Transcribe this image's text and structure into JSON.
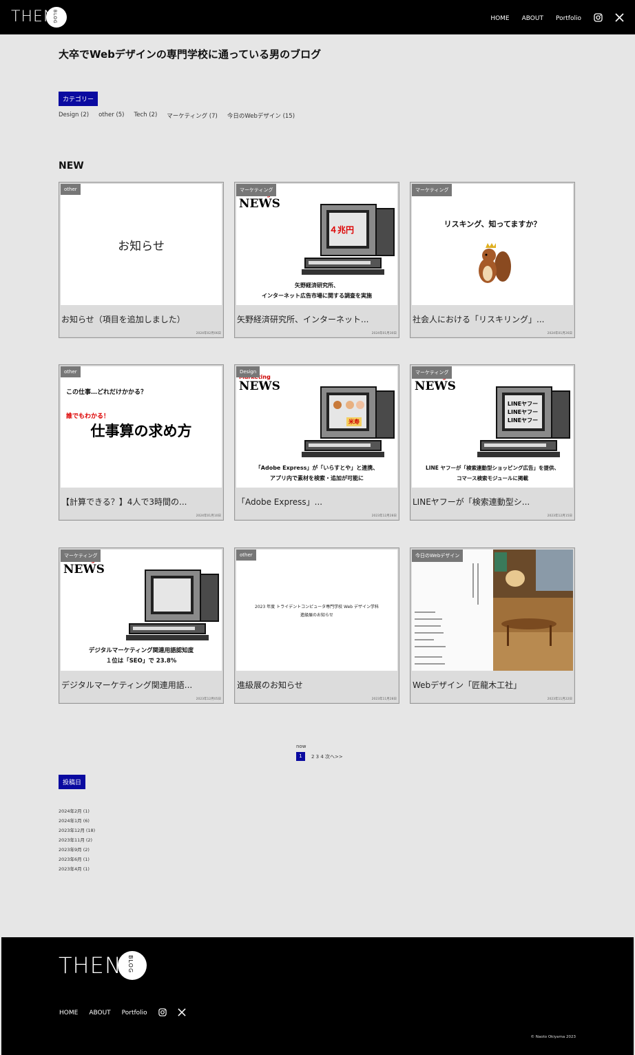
{
  "header": {
    "logo_text": "THEN",
    "logo_sub": "BLOG",
    "nav": [
      "HOME",
      "ABOUT",
      "Portfolio"
    ],
    "icons": [
      "instagram-icon",
      "x-icon"
    ]
  },
  "site_title": "大卒でWebデザインの専門学校に通っている男のブログ",
  "categories": {
    "label": "カテゴリー",
    "items": [
      "Design (2)",
      "other (5)",
      "Tech (2)",
      "マーケティング (7)",
      "今日のWebデザイン (15)"
    ]
  },
  "new_heading": "NEW",
  "cards": [
    {
      "tag": "other",
      "title": "お知らせ（項目を追加しました）",
      "date": "2024年02月06日",
      "thumb_text": "お知らせ"
    },
    {
      "tag": "マーケティング",
      "title": "矢野経済研究所、インターネット...",
      "date": "2024年01月30日",
      "news_mk": "Marketing",
      "news_word": "NEWS",
      "screen_text": "４兆円",
      "caption": [
        "矢野経済研究所、",
        "インターネット広告市場に関する調査を実施"
      ]
    },
    {
      "tag": "マーケティング",
      "title": "社会人における「リスキリング」...",
      "date": "2024年01月26日",
      "thumb_text": "リスキング、知ってますか？"
    },
    {
      "tag": "other",
      "title": "【計算できる？】4人で3時間の...",
      "date": "2024年01月10日",
      "line1": "この仕事…どれだけかかる？",
      "line2": "誰でもわかる！",
      "line3": "仕事算の求め方"
    },
    {
      "tag": "Design",
      "title": "「Adobe Express」...",
      "date": "2023年12月28日",
      "news_mk": "Marketing",
      "news_word": "NEWS",
      "screen_text": "米寿",
      "caption": [
        "「Adobe Express」が「いらすとや」と連携、",
        "アプリ内で素材を検索・追加が可能に"
      ]
    },
    {
      "tag": "マーケティング",
      "title": "LINEヤフーが「検索連動型シ...",
      "date": "2023年12月15日",
      "news_mk": "Marketing",
      "news_word": "NEWS",
      "screen_text": "LINEヤフー",
      "caption": [
        "LINE ヤフーが「検索連動型ショッピング広告」を提供、",
        "コマース検索モジュールに掲載"
      ]
    },
    {
      "tag": "マーケティング",
      "title": "デジタルマーケティング関連用語...",
      "date": "2023年12月05日",
      "news_mk": "Marketing",
      "news_word": "NEWS",
      "screen_text": "",
      "caption": [
        "デジタルマーケティング関連用語認知度",
        "１位は「SEO」で 23.8%"
      ]
    },
    {
      "tag": "other",
      "title": "進級展のお知らせ",
      "date": "2023年11月28日",
      "caption": [
        "2023 年度 トライデントコンピュータ専門学校 Web デザイン学科",
        "進級展のお知らせ"
      ]
    },
    {
      "tag": "今日のWebデザイン",
      "title": "Webデザイン「匠龍木工社」",
      "date": "2023年11月22日"
    }
  ],
  "pager": {
    "now": "now",
    "current": "1",
    "rest": "2 3 4 次へ>>"
  },
  "archive": {
    "label": "投稿日",
    "items": [
      "2024年2月 (1)",
      "2024年1月 (6)",
      "2023年12月 (18)",
      "2023年11月 (2)",
      "2023年9月 (2)",
      "2023年6月 (1)",
      "2023年4月 (1)"
    ]
  },
  "footer": {
    "logo_text": "THEN",
    "logo_sub": "BLOG",
    "nav": [
      "HOME",
      "ABOUT",
      "Portfolio"
    ],
    "copyright": "© Naoto Okiyama 2023"
  },
  "colors": {
    "accent": "#0a0aa0",
    "header_bg": "#000000",
    "page_bg": "#e6e6e6"
  }
}
